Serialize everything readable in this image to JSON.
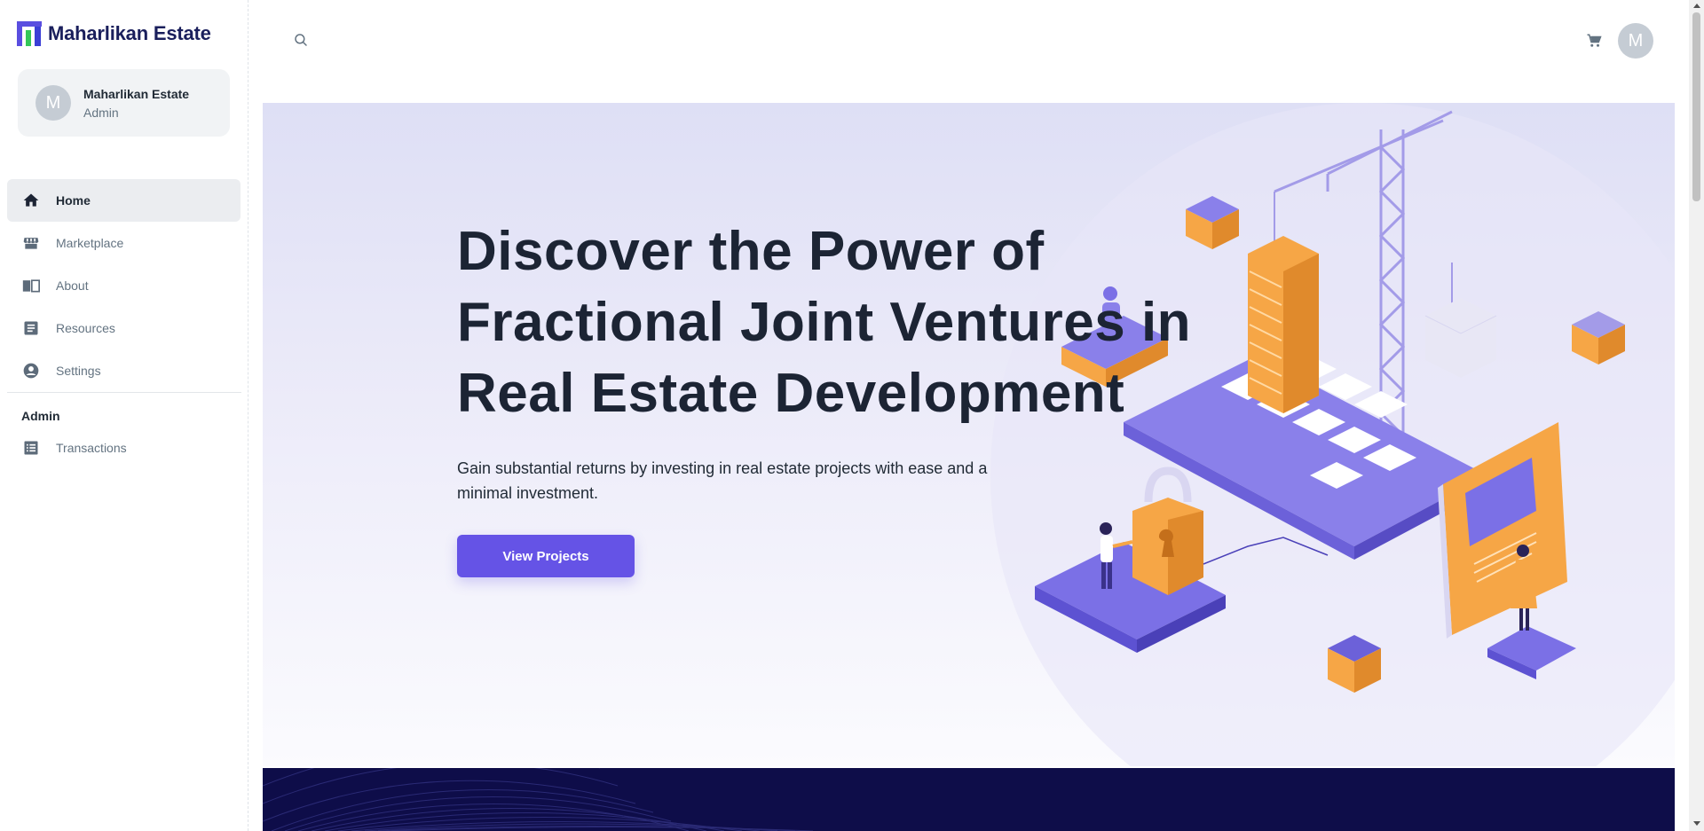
{
  "brand": {
    "name": "Maharlikan Estate"
  },
  "account": {
    "initial": "M",
    "name": "Maharlikan Estate",
    "role": "Admin"
  },
  "nav": {
    "items": [
      {
        "label": "Home",
        "icon": "home-icon",
        "active": true
      },
      {
        "label": "Marketplace",
        "icon": "store-icon"
      },
      {
        "label": "About",
        "icon": "book-open-icon"
      },
      {
        "label": "Resources",
        "icon": "document-icon"
      },
      {
        "label": "Settings",
        "icon": "user-circle-icon"
      }
    ],
    "admin_section": "Admin",
    "admin_items": [
      {
        "label": "Transactions",
        "icon": "receipt-icon"
      }
    ]
  },
  "header": {
    "avatar_initial": "M",
    "search_icon": "search-icon",
    "cart_icon": "cart-icon"
  },
  "hero": {
    "title": "Discover the Power of Fractional Joint Ventures in Real Estate Development",
    "subtitle": "Gain substantial returns by investing in real estate projects with ease and a minimal investment.",
    "cta_label": "View Projects"
  },
  "colors": {
    "accent": "#6553e6",
    "dark_band": "#0e0d49",
    "orange": "#f6a646"
  }
}
